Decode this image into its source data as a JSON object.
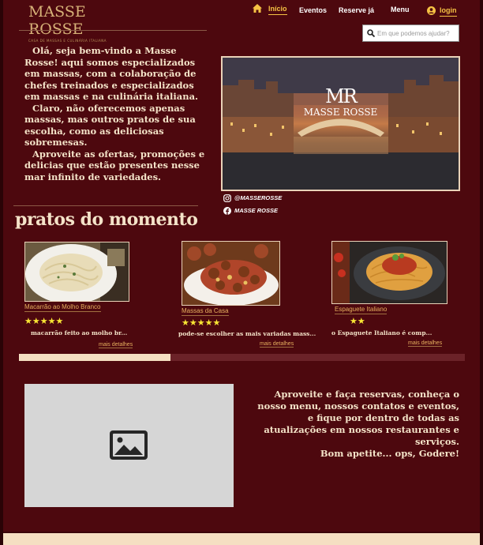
{
  "brand": {
    "name": "MASSE ROSSE",
    "tagline": "CASA DE MASSAS E CULINÁRIA ITALIANA"
  },
  "nav": {
    "home": "Início",
    "events": "Eventos",
    "reserve": "Reserve já",
    "menu": "Menu",
    "login": "login"
  },
  "search": {
    "placeholder": "Em que podemos ajudar?"
  },
  "intro": {
    "paragraphs": [
      "Olá, seja bem-vindo a Masse Rosse! aqui somos especializados em massas, com a colaboração de chefes treinados e especializados em massas e na culinária italiana.",
      "Claro, não oferecemos apenas massas, mas outros pratos de sua escolha, como as deliciosas sobremesas.",
      "Aproveite as ofertas, promoções e delicias que estão presentes nesse mar infinito de variedades."
    ]
  },
  "hero": {
    "mark": "MR",
    "name": "MASSE ROSSE"
  },
  "social": {
    "instagram": "@MASSEROSSE",
    "facebook": "MASSE ROSSE"
  },
  "section_title": "pratos do momento",
  "dishes": [
    {
      "name": "Macarrão ao Molho Branco",
      "stars": "★★★★★",
      "rating": 5,
      "desc": "macarrão feito ao molho br...",
      "more": "mais detalhes"
    },
    {
      "name": "Massas da Casa",
      "stars": "★★★★★",
      "rating": 5,
      "desc": "pode-se escolher as mais variadas mass...",
      "more": "mais detalhes"
    },
    {
      "name": "Espaguete Italiano",
      "stars": "★★",
      "rating": 2,
      "desc": "o Espaguete Italiano é comp...",
      "more": "mais detalhes"
    }
  ],
  "carousel": {
    "position": 0.34
  },
  "cta": {
    "text": "Aproveite e faça reservas, conheça o nosso menu, nossos contatos e eventos, e fique por dentro de todas as atualizações em nossos restaurantes e serviços.",
    "closing": "Bom apetite... ops, Godere!"
  },
  "colors": {
    "background": "#4d080e",
    "accent": "#f6c244",
    "cream": "#f4e3c8",
    "star": "#f8e634"
  }
}
